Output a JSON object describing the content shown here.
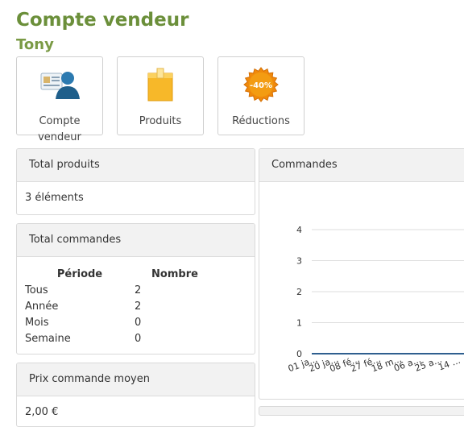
{
  "page": {
    "title": "Compte vendeur",
    "subtitle": "Tony"
  },
  "tiles": [
    {
      "label": "Compte vendeur",
      "icon": "seller-account-icon"
    },
    {
      "label": "Produits",
      "icon": "product-box-icon"
    },
    {
      "label": "Réductions",
      "icon": "discount-badge-icon"
    }
  ],
  "discount_badge_text": "-40%",
  "panels": {
    "total_products": {
      "title": "Total produits",
      "value": "3 éléments"
    },
    "total_orders": {
      "title": "Total commandes",
      "columns": [
        "Période",
        "Nombre"
      ],
      "rows": [
        {
          "period": "Tous",
          "count": "2"
        },
        {
          "period": "Année",
          "count": "2"
        },
        {
          "period": "Mois",
          "count": "0"
        },
        {
          "period": "Semaine",
          "count": "0"
        }
      ]
    },
    "avg_price": {
      "title": "Prix commande moyen",
      "value": "2,00 €"
    },
    "orders_chart": {
      "title": "Commandes"
    }
  },
  "chart_data": {
    "type": "line",
    "title": "Commandes",
    "categories": [
      "01 ja...",
      "20 ja...",
      "08 fé...",
      "27 fé...",
      "18 m...",
      "06 a...",
      "25 a...",
      "14 ..."
    ],
    "series": [
      {
        "values": [
          0,
          0,
          0,
          0,
          0,
          0,
          0,
          0
        ]
      }
    ],
    "yticks": [
      "0",
      "1",
      "2",
      "3",
      "4"
    ],
    "ylim": [
      0,
      4
    ],
    "grid": true,
    "line_color": "#2f5f8f"
  }
}
